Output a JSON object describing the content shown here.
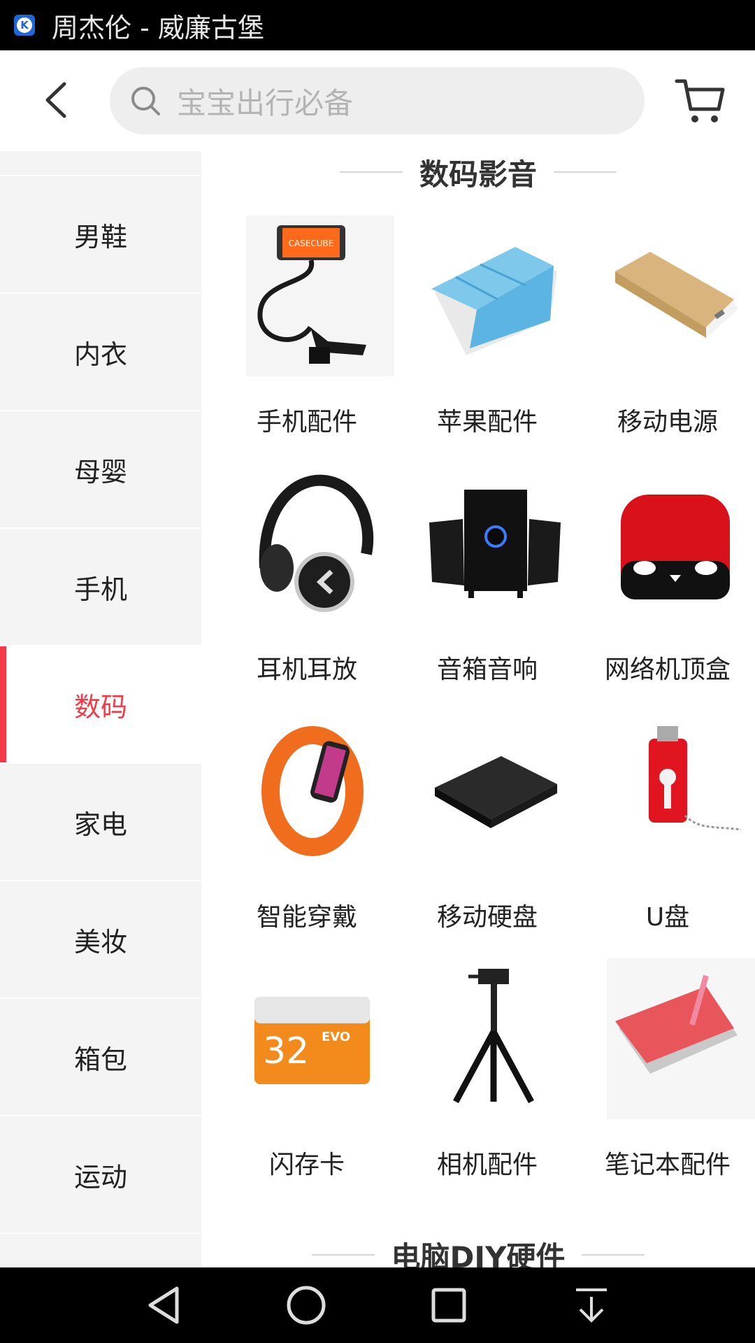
{
  "status_bar": {
    "notification_text": "周杰伦 - 威廉古堡"
  },
  "search": {
    "placeholder": "宝宝出行必备"
  },
  "sidebar": {
    "items": [
      {
        "label": "男鞋"
      },
      {
        "label": "内衣"
      },
      {
        "label": "母婴"
      },
      {
        "label": "手机"
      },
      {
        "label": "数码",
        "active": true
      },
      {
        "label": "家电"
      },
      {
        "label": "美妆"
      },
      {
        "label": "箱包"
      },
      {
        "label": "运动"
      }
    ]
  },
  "sections": [
    {
      "title": "数码影音",
      "items": [
        {
          "label": "手机配件",
          "icon": "phone-holder-icon"
        },
        {
          "label": "苹果配件",
          "icon": "tablet-case-icon"
        },
        {
          "label": "移动电源",
          "icon": "power-bank-icon"
        },
        {
          "label": "耳机耳放",
          "icon": "headphones-icon"
        },
        {
          "label": "音箱音响",
          "icon": "speakers-icon"
        },
        {
          "label": "网络机顶盒",
          "icon": "set-top-box-icon"
        },
        {
          "label": "智能穿戴",
          "icon": "smart-band-icon"
        },
        {
          "label": "移动硬盘",
          "icon": "external-hdd-icon"
        },
        {
          "label": "U盘",
          "icon": "usb-drive-icon"
        },
        {
          "label": "闪存卡",
          "icon": "memory-card-icon",
          "card_text": "32",
          "card_badge": "EVO"
        },
        {
          "label": "相机配件",
          "icon": "tripod-icon"
        },
        {
          "label": "笔记本配件",
          "icon": "laptop-sleeve-icon"
        }
      ]
    },
    {
      "title": "电脑DIY硬件"
    }
  ],
  "colors": {
    "accent": "#f23a48",
    "sidebar_bg": "#f4f4f4",
    "search_bg": "#eeeeee"
  }
}
